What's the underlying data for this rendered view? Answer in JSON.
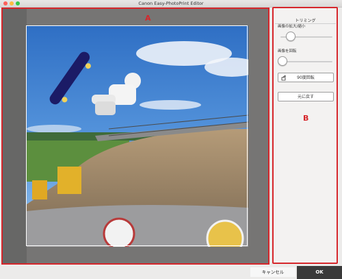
{
  "window": {
    "title": "Canon Easy-PhotoPrint Editor"
  },
  "callouts": {
    "a": "A",
    "b": "B"
  },
  "panel": {
    "title": "トリミング",
    "zoom_label": "画像の拡大/縮小",
    "zoom_level": 0.0,
    "rotate_label": "画像を回転",
    "rotate_level": 0.0,
    "rotate90_button": "90度回転",
    "reset_button": "元に戻す"
  },
  "footer": {
    "cancel": "キャンセル",
    "ok": "OK"
  },
  "colors": {
    "callout": "#d6262b",
    "ok_background": "#3a3a3a"
  }
}
